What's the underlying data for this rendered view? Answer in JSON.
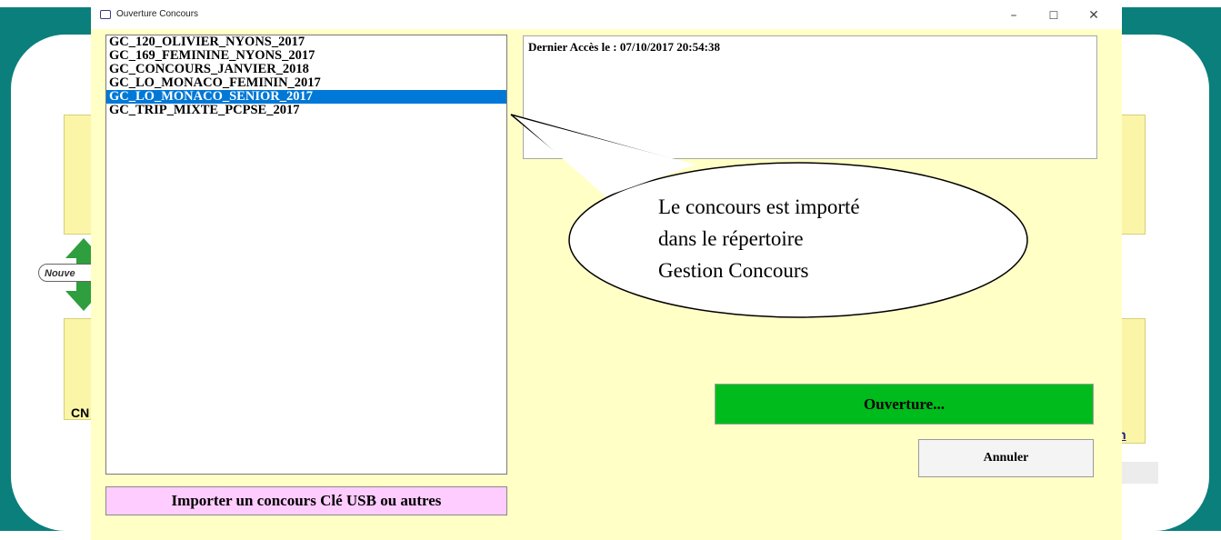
{
  "background_app": {
    "pill_text": "Nouve",
    "tile_text": "CN",
    "link_text": "n"
  },
  "dialog": {
    "title": "Ouverture Concours",
    "window_controls": {
      "minimize": "–",
      "maximize": "☐",
      "close": "✕"
    },
    "concours_list": [
      "GC_120_OLIVIER_NYONS_2017",
      "GC_169_FEMININE_NYONS_2017",
      "GC_CONCOURS_JANVIER_2018",
      "GC_LO_MONACO_FEMININ_2017",
      "GC_LO_MONACO_SENIOR_2017",
      "GC_TRIP_MIXTE_PCPSE_2017"
    ],
    "selected_index": 4,
    "info_text": "Dernier Accès le : 07/10/2017 20:54:38",
    "open_button": "Ouverture...",
    "cancel_button": "Annuler",
    "import_button": "Importer un concours Clé USB ou autres"
  },
  "callout": {
    "line1": "Le concours est importé",
    "line2": "dans le répertoire",
    "line3": "Gestion Concours"
  },
  "colors": {
    "dialog_bg": "#ffffc6",
    "selection": "#0078d7",
    "open_button": "#00bb1c",
    "import_button": "#ffccff",
    "background_teal": "#0b7f7c"
  }
}
